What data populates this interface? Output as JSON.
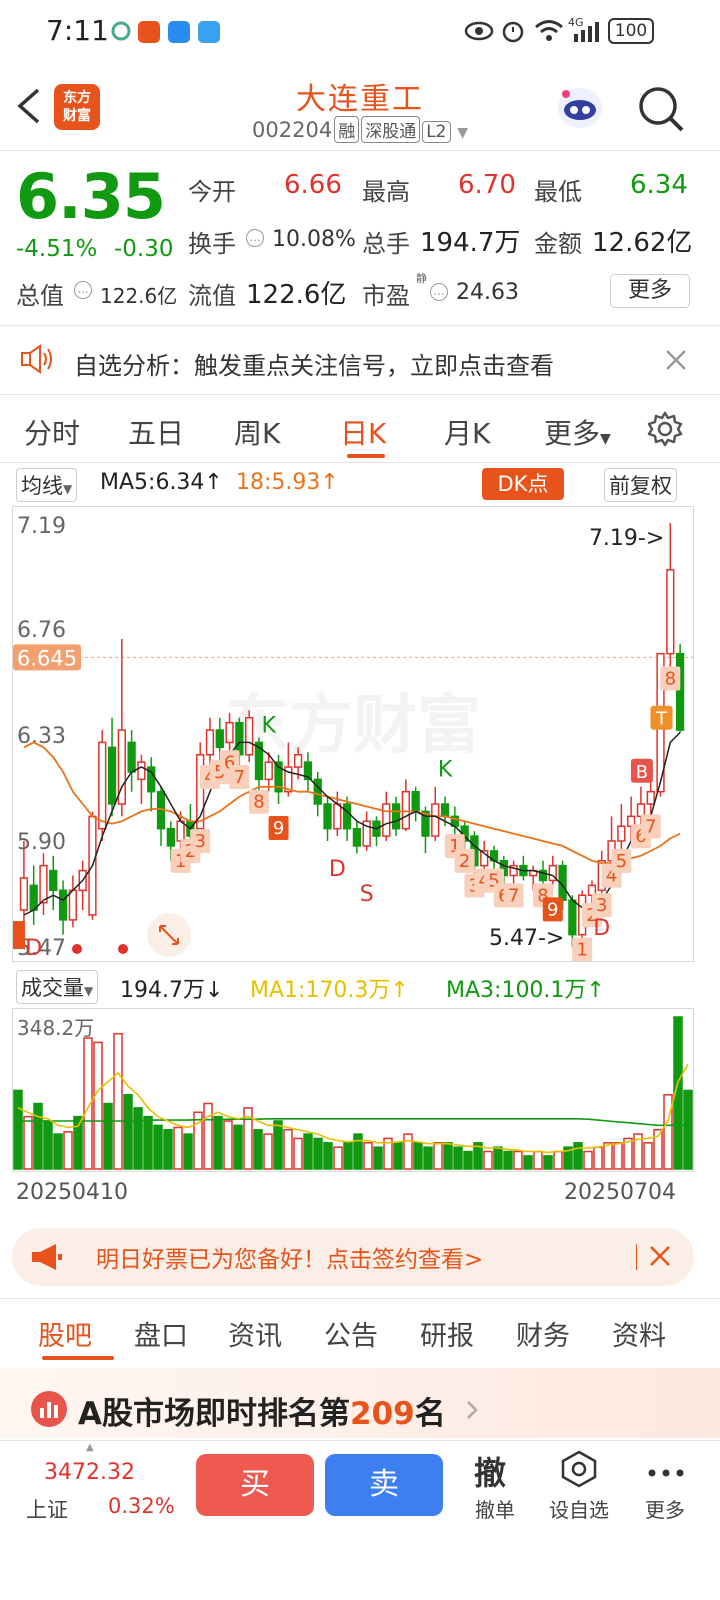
{
  "status": {
    "time": "7:11",
    "battery": "100",
    "network": "4G"
  },
  "header": {
    "title": "大连重工",
    "code": "002204",
    "tags": [
      "融",
      "深股通",
      "L2"
    ],
    "logo_line1": "东方",
    "logo_line2": "财富"
  },
  "quote": {
    "price": "6.35",
    "change_pct": "-4.51%",
    "change_abs": "-0.30",
    "open_label": "今开",
    "open": "6.66",
    "high_label": "最高",
    "high": "6.70",
    "low_label": "最低",
    "low": "6.34",
    "turnover_label": "换手",
    "turnover": "10.08%",
    "volume_label": "总手",
    "volume": "194.7万",
    "amount_label": "金额",
    "amount": "12.62亿",
    "mktcap_label": "总值",
    "mktcap": "122.6亿",
    "float_label": "流值",
    "float": "122.6亿",
    "pe_label": "市盈",
    "pe_sup": "静",
    "pe": "24.63",
    "more_label": "更多"
  },
  "notice": {
    "text": "自选分析：触发重点关注信号，立即点击查看"
  },
  "period_tabs": [
    "分时",
    "五日",
    "周K",
    "日K",
    "月K",
    "更多"
  ],
  "chart_toolbar": {
    "indicator": "均线",
    "ma5": "MA5:6.34↑",
    "ma18": "18:5.93↑",
    "dk": "DK点",
    "adjust": "前复权"
  },
  "chart_data": [
    {
      "type": "candlestick",
      "y_ticks": [
        "7.19",
        "6.76",
        "6.33",
        "5.90",
        "5.47"
      ],
      "ylim": [
        5.47,
        7.19
      ],
      "ref_line": "6.645",
      "max_label": "7.19->",
      "min_label": "5.47->",
      "x_start": "20250410",
      "x_end": "20250704",
      "signal_labels": [
        "1",
        "2",
        "3",
        "4",
        "5",
        "6",
        "7",
        "8",
        "9",
        "K",
        "D",
        "S",
        "B",
        "T"
      ],
      "watermark": "东方财富",
      "candles": [
        {
          "o": 5.62,
          "c": 5.75,
          "h": 5.9,
          "l": 5.5
        },
        {
          "o": 5.72,
          "c": 5.62,
          "h": 5.8,
          "l": 5.56
        },
        {
          "o": 5.65,
          "c": 5.8,
          "h": 5.85,
          "l": 5.6
        },
        {
          "o": 5.78,
          "c": 5.7,
          "h": 5.84,
          "l": 5.62
        },
        {
          "o": 5.7,
          "c": 5.58,
          "h": 5.74,
          "l": 5.52
        },
        {
          "o": 5.58,
          "c": 5.7,
          "h": 5.76,
          "l": 5.55
        },
        {
          "o": 5.7,
          "c": 5.78,
          "h": 5.82,
          "l": 5.62
        },
        {
          "o": 5.6,
          "c": 6.0,
          "h": 6.02,
          "l": 5.58
        },
        {
          "o": 5.95,
          "c": 6.3,
          "h": 6.35,
          "l": 5.9
        },
        {
          "o": 6.28,
          "c": 6.05,
          "h": 6.4,
          "l": 6.0
        },
        {
          "o": 6.05,
          "c": 6.35,
          "h": 6.72,
          "l": 6.0
        },
        {
          "o": 6.3,
          "c": 6.18,
          "h": 6.35,
          "l": 6.1
        },
        {
          "o": 6.15,
          "c": 6.22,
          "h": 6.25,
          "l": 6.05
        },
        {
          "o": 6.2,
          "c": 6.1,
          "h": 6.24,
          "l": 6.02
        },
        {
          "o": 6.1,
          "c": 5.95,
          "h": 6.12,
          "l": 5.88
        },
        {
          "o": 5.95,
          "c": 5.88,
          "h": 5.98,
          "l": 5.82
        },
        {
          "o": 5.9,
          "c": 5.98,
          "h": 6.02,
          "l": 5.86
        },
        {
          "o": 5.98,
          "c": 5.92,
          "h": 6.05,
          "l": 5.9
        },
        {
          "o": 5.95,
          "c": 6.25,
          "h": 6.3,
          "l": 5.94
        },
        {
          "o": 6.25,
          "c": 6.35,
          "h": 6.4,
          "l": 6.2
        },
        {
          "o": 6.35,
          "c": 6.28,
          "h": 6.4,
          "l": 6.22
        },
        {
          "o": 6.3,
          "c": 6.38,
          "h": 6.42,
          "l": 6.26
        },
        {
          "o": 6.38,
          "c": 6.25,
          "h": 6.4,
          "l": 6.2
        },
        {
          "o": 6.25,
          "c": 6.4,
          "h": 6.43,
          "l": 6.22
        },
        {
          "o": 6.3,
          "c": 6.15,
          "h": 6.32,
          "l": 6.1
        },
        {
          "o": 6.15,
          "c": 6.22,
          "h": 6.26,
          "l": 6.1
        },
        {
          "o": 6.22,
          "c": 6.1,
          "h": 6.25,
          "l": 6.05
        },
        {
          "o": 6.1,
          "c": 6.2,
          "h": 6.3,
          "l": 6.08
        },
        {
          "o": 6.2,
          "c": 6.25,
          "h": 6.28,
          "l": 6.15
        },
        {
          "o": 6.22,
          "c": 6.15,
          "h": 6.26,
          "l": 6.1
        },
        {
          "o": 6.15,
          "c": 6.05,
          "h": 6.18,
          "l": 6.0
        },
        {
          "o": 6.05,
          "c": 5.95,
          "h": 6.08,
          "l": 5.9
        },
        {
          "o": 5.95,
          "c": 6.05,
          "h": 6.1,
          "l": 5.92
        },
        {
          "o": 6.05,
          "c": 5.95,
          "h": 6.08,
          "l": 5.9
        },
        {
          "o": 5.95,
          "c": 5.88,
          "h": 5.98,
          "l": 5.85
        },
        {
          "o": 5.88,
          "c": 5.98,
          "h": 6.02,
          "l": 5.86
        },
        {
          "o": 5.98,
          "c": 5.92,
          "h": 6.0,
          "l": 5.88
        },
        {
          "o": 5.92,
          "c": 6.05,
          "h": 6.1,
          "l": 5.9
        },
        {
          "o": 6.05,
          "c": 5.95,
          "h": 6.08,
          "l": 5.92
        },
        {
          "o": 5.95,
          "c": 6.1,
          "h": 6.15,
          "l": 5.94
        },
        {
          "o": 6.1,
          "c": 6.02,
          "h": 6.12,
          "l": 5.98
        },
        {
          "o": 6.02,
          "c": 5.92,
          "h": 6.04,
          "l": 5.85
        },
        {
          "o": 5.92,
          "c": 6.05,
          "h": 6.12,
          "l": 5.9
        },
        {
          "o": 6.05,
          "c": 6.0,
          "h": 6.08,
          "l": 5.96
        },
        {
          "o": 6.0,
          "c": 5.96,
          "h": 6.04,
          "l": 5.92
        },
        {
          "o": 5.96,
          "c": 5.9,
          "h": 5.98,
          "l": 5.86
        },
        {
          "o": 5.92,
          "c": 5.8,
          "h": 5.94,
          "l": 5.76
        },
        {
          "o": 5.8,
          "c": 5.86,
          "h": 5.9,
          "l": 5.78
        },
        {
          "o": 5.86,
          "c": 5.82,
          "h": 5.88,
          "l": 5.78
        },
        {
          "o": 5.82,
          "c": 5.76,
          "h": 5.84,
          "l": 5.72
        },
        {
          "o": 5.76,
          "c": 5.8,
          "h": 5.82,
          "l": 5.72
        },
        {
          "o": 5.8,
          "c": 5.76,
          "h": 5.84,
          "l": 5.74
        },
        {
          "o": 5.76,
          "c": 5.78,
          "h": 5.8,
          "l": 5.7
        },
        {
          "o": 5.78,
          "c": 5.74,
          "h": 5.82,
          "l": 5.72
        },
        {
          "o": 5.74,
          "c": 5.8,
          "h": 5.84,
          "l": 5.72
        },
        {
          "o": 5.8,
          "c": 5.66,
          "h": 5.82,
          "l": 5.62
        },
        {
          "o": 5.66,
          "c": 5.52,
          "h": 5.68,
          "l": 5.47
        },
        {
          "o": 5.52,
          "c": 5.68,
          "h": 5.7,
          "l": 5.5
        },
        {
          "o": 5.68,
          "c": 5.72,
          "h": 5.74,
          "l": 5.64
        },
        {
          "o": 5.7,
          "c": 5.82,
          "h": 5.86,
          "l": 5.68
        },
        {
          "o": 5.82,
          "c": 5.9,
          "h": 6.0,
          "l": 5.8
        },
        {
          "o": 5.9,
          "c": 5.96,
          "h": 6.05,
          "l": 5.86
        },
        {
          "o": 5.96,
          "c": 6.0,
          "h": 6.08,
          "l": 5.9
        },
        {
          "o": 6.0,
          "c": 6.05,
          "h": 6.12,
          "l": 5.96
        },
        {
          "o": 6.05,
          "c": 6.1,
          "h": 6.2,
          "l": 6.0
        },
        {
          "o": 6.1,
          "c": 6.66,
          "h": 6.66,
          "l": 6.08
        },
        {
          "o": 6.66,
          "c": 7.0,
          "h": 7.19,
          "l": 6.6
        },
        {
          "o": 6.66,
          "c": 6.35,
          "h": 6.7,
          "l": 6.34
        }
      ],
      "ma5": [
        5.6,
        5.62,
        5.66,
        5.68,
        5.66,
        5.7,
        5.74,
        5.8,
        5.92,
        6.02,
        6.12,
        6.18,
        6.2,
        6.18,
        6.12,
        6.05,
        5.98,
        5.95,
        6.0,
        6.1,
        6.2,
        6.25,
        6.3,
        6.3,
        6.28,
        6.25,
        6.2,
        6.18,
        6.17,
        6.16,
        6.12,
        6.08,
        6.05,
        6.02,
        5.98,
        5.96,
        5.95,
        5.97,
        5.98,
        6.0,
        6.02,
        6.0,
        6.0,
        5.98,
        5.96,
        5.92,
        5.88,
        5.85,
        5.82,
        5.8,
        5.79,
        5.78,
        5.78,
        5.77,
        5.76,
        5.72,
        5.66,
        5.63,
        5.62,
        5.66,
        5.72,
        5.82,
        5.9,
        5.96,
        6.0,
        6.14,
        6.3,
        6.34
      ],
      "ma18": [
        6.28,
        6.3,
        6.28,
        6.24,
        6.18,
        6.1,
        6.05,
        6.0,
        5.98,
        5.97,
        5.98,
        6.0,
        6.02,
        6.03,
        6.03,
        6.02,
        6.0,
        5.98,
        5.98,
        6.0,
        6.02,
        6.05,
        6.08,
        6.1,
        6.12,
        6.12,
        6.12,
        6.11,
        6.1,
        6.1,
        6.09,
        6.08,
        6.07,
        6.06,
        6.05,
        6.04,
        6.03,
        6.02,
        6.02,
        6.02,
        6.02,
        6.01,
        6.0,
        6.0,
        5.99,
        5.98,
        5.97,
        5.96,
        5.95,
        5.94,
        5.93,
        5.92,
        5.91,
        5.9,
        5.89,
        5.88,
        5.86,
        5.84,
        5.82,
        5.81,
        5.81,
        5.82,
        5.83,
        5.84,
        5.86,
        5.88,
        5.91,
        5.93
      ]
    },
    {
      "type": "bar",
      "indicator": "成交量",
      "volume_value": "194.7万↓",
      "ma1": "MA1:170.3万↑",
      "ma3": "MA3:100.1万↑",
      "max_label": "348.2万",
      "ylim": [
        0,
        348.2
      ],
      "values": [
        180,
        120,
        150,
        110,
        80,
        85,
        120,
        300,
        290,
        150,
        310,
        170,
        140,
        120,
        100,
        90,
        95,
        80,
        130,
        150,
        120,
        110,
        100,
        140,
        90,
        80,
        110,
        90,
        70,
        80,
        70,
        60,
        50,
        60,
        80,
        60,
        50,
        70,
        60,
        80,
        60,
        50,
        60,
        60,
        50,
        40,
        60,
        40,
        50,
        40,
        40,
        30,
        40,
        30,
        40,
        50,
        60,
        40,
        50,
        60,
        60,
        70,
        80,
        60,
        90,
        170,
        348.2,
        180
      ],
      "up": [
        false,
        true,
        false,
        false,
        false,
        true,
        false,
        true,
        true,
        false,
        true,
        false,
        false,
        false,
        false,
        false,
        true,
        false,
        true,
        true,
        false,
        true,
        false,
        true,
        false,
        true,
        false,
        true,
        true,
        false,
        false,
        false,
        true,
        false,
        false,
        true,
        false,
        true,
        false,
        true,
        false,
        false,
        true,
        false,
        false,
        false,
        false,
        true,
        false,
        false,
        true,
        false,
        true,
        false,
        true,
        false,
        false,
        true,
        true,
        true,
        true,
        true,
        true,
        true,
        true,
        true,
        false,
        false
      ],
      "ma1_line": [
        140,
        130,
        120,
        115,
        100,
        95,
        98,
        140,
        180,
        200,
        220,
        190,
        170,
        140,
        120,
        110,
        100,
        95,
        105,
        120,
        130,
        120,
        115,
        120,
        110,
        100,
        100,
        95,
        90,
        85,
        80,
        70,
        65,
        62,
        65,
        65,
        60,
        60,
        62,
        65,
        62,
        58,
        58,
        58,
        55,
        52,
        52,
        48,
        48,
        45,
        43,
        40,
        40,
        38,
        40,
        42,
        48,
        48,
        50,
        55,
        58,
        62,
        68,
        70,
        75,
        110,
        200,
        240
      ],
      "ma3_line": [
        110,
        110,
        110,
        110,
        110,
        110,
        110,
        110,
        110,
        110,
        110,
        110,
        110,
        112,
        112,
        112,
        112,
        112,
        113,
        113,
        113,
        114,
        114,
        114,
        114,
        115,
        115,
        115,
        115,
        115,
        115,
        115,
        115,
        115,
        115,
        115,
        115,
        115,
        115,
        115,
        115,
        115,
        115,
        115,
        115,
        115,
        115,
        115,
        115,
        115,
        115,
        115,
        115,
        115,
        115,
        115,
        115,
        114,
        112,
        110,
        108,
        106,
        104,
        102,
        100,
        100,
        100,
        100.1
      ]
    }
  ],
  "banner": {
    "text": "明日好票已为您备好！点击签约查看>"
  },
  "bottom_tabs": [
    "股吧",
    "盘口",
    "资讯",
    "公告",
    "研报",
    "财务",
    "资料"
  ],
  "rank": {
    "prefix": "A股市场即时排名第",
    "num": "209",
    "suffix": "名"
  },
  "bottom_bar": {
    "index_value": "3472.32",
    "index_name": "上证",
    "index_pct": "0.32%",
    "buy": "买",
    "sell": "卖",
    "cancel_icon": "撤",
    "cancel": "撤单",
    "watch": "设自选",
    "more": "更多"
  },
  "colors": {
    "accent": "#e8531b",
    "up": "#e0332b",
    "down": "#119911",
    "ma5": "#222222",
    "ma18": "#e8731b",
    "vol_ma1": "#e6c000",
    "vol_ma3": "#119911"
  }
}
